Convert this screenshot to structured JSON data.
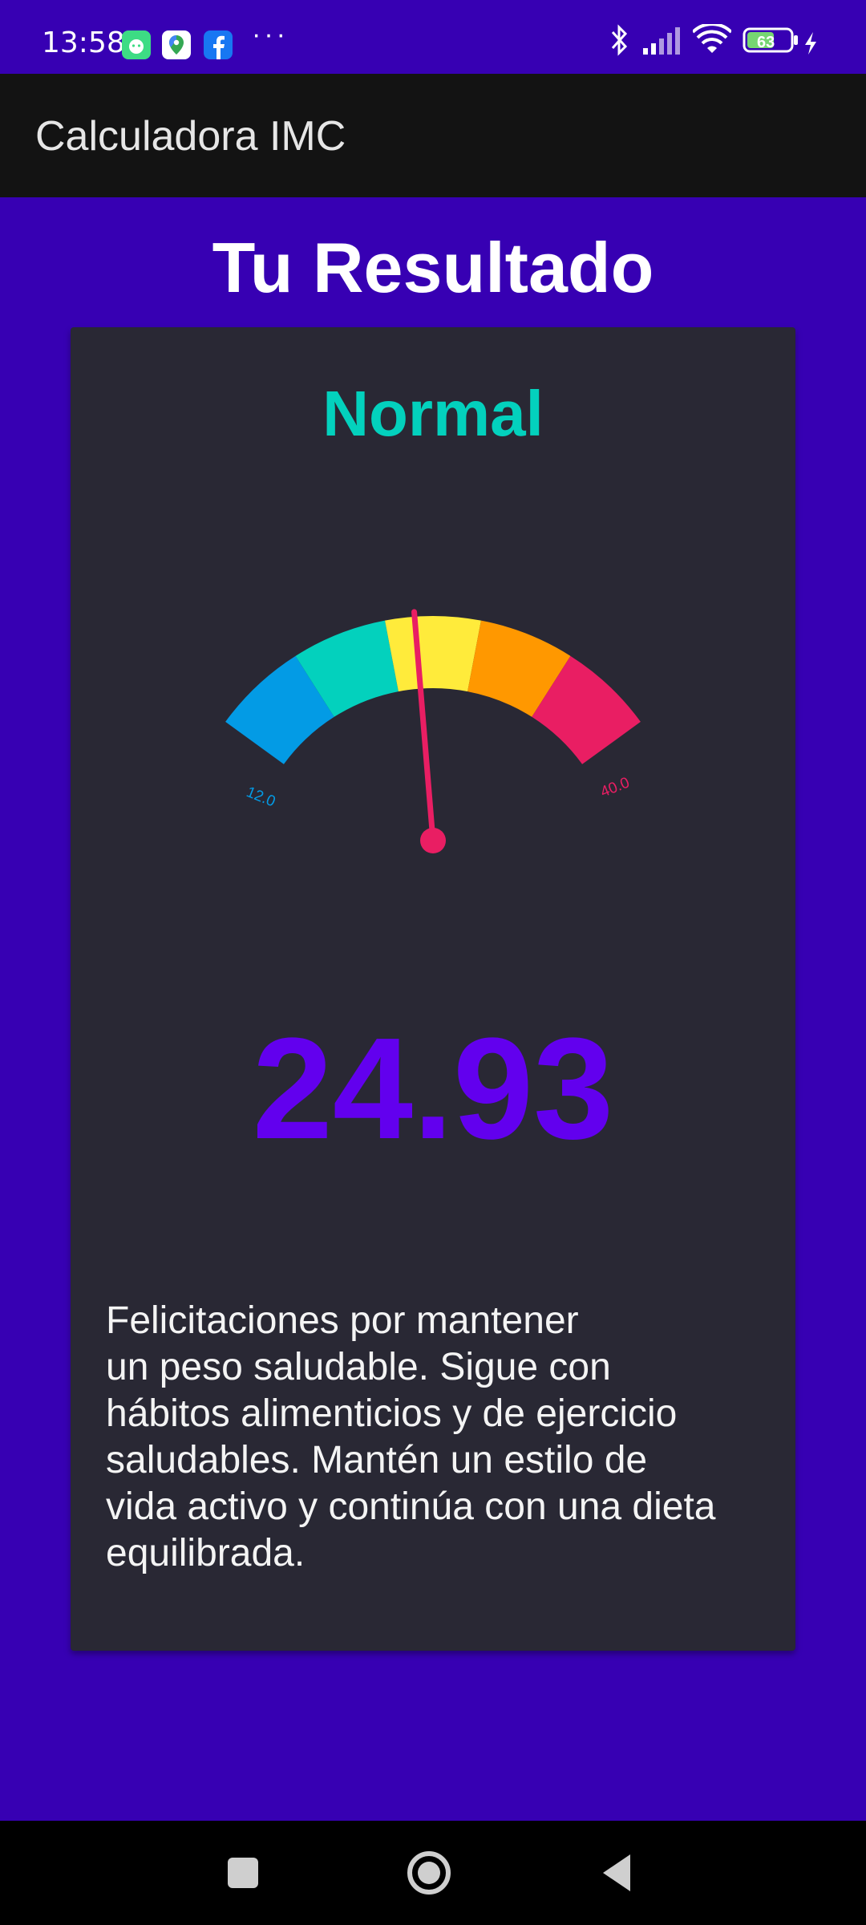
{
  "status_bar": {
    "time": "13:58",
    "battery": "63",
    "icons": [
      "bluetooth-icon",
      "signal-icon",
      "wifi-icon",
      "battery-icon",
      "charging-icon"
    ],
    "app_icons": [
      "android-icon",
      "maps-icon",
      "facebook-icon"
    ],
    "overflow": "···"
  },
  "app_bar": {
    "title": "Calculadora IMC"
  },
  "main": {
    "heading": "Tu Resultado",
    "card": {
      "category": "Normal",
      "category_color": "#03d1bd",
      "bmi_value": "24.93",
      "bmi_color": "#6200ee",
      "message": "Felicitaciones por mantener\nun peso saludable. Sigue con\nhábitos alimenticios y de ejercicio\nsaludables. Mantén un estilo de\nvida activo y continúa con una dieta\nequilibrada."
    }
  },
  "gauge": {
    "min_label": "12.0",
    "max_label": "40.0",
    "min": 12.0,
    "max": 40.0,
    "value": 24.93,
    "segments": [
      {
        "color": "#039be5"
      },
      {
        "color": "#03d1bd"
      },
      {
        "color": "#ffeb3b"
      },
      {
        "color": "#ff9800"
      },
      {
        "color": "#e91e63"
      }
    ],
    "needle_color": "#e91e63"
  },
  "colors": {
    "background": "#3700b3",
    "app_bar": "#131313",
    "card": "#292834"
  },
  "nav_bar": {
    "buttons": [
      "recents-button",
      "home-button",
      "back-button"
    ]
  }
}
